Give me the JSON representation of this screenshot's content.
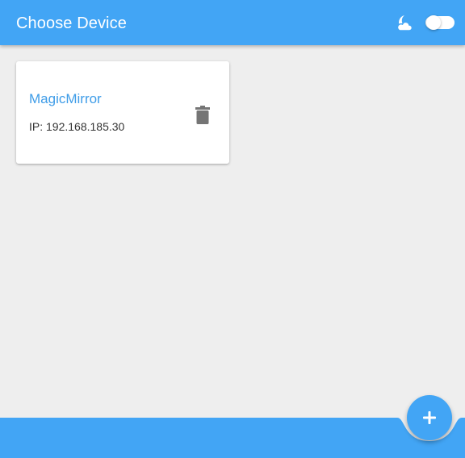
{
  "app_bar": {
    "title": "Choose Device",
    "night_mode_icon": "night-moon-cloud-icon",
    "theme_toggle_state": "off"
  },
  "devices": [
    {
      "name": "MagicMirror",
      "ip": "IP: 192.168.185.30",
      "delete_icon": "trash-icon"
    }
  ],
  "fab": {
    "icon": "plus-icon"
  },
  "colors": {
    "primary": "#42a5f5",
    "background": "#eeeeee",
    "card": "#ffffff",
    "device_name": "#3f9de8",
    "icon_gray": "#757575"
  }
}
